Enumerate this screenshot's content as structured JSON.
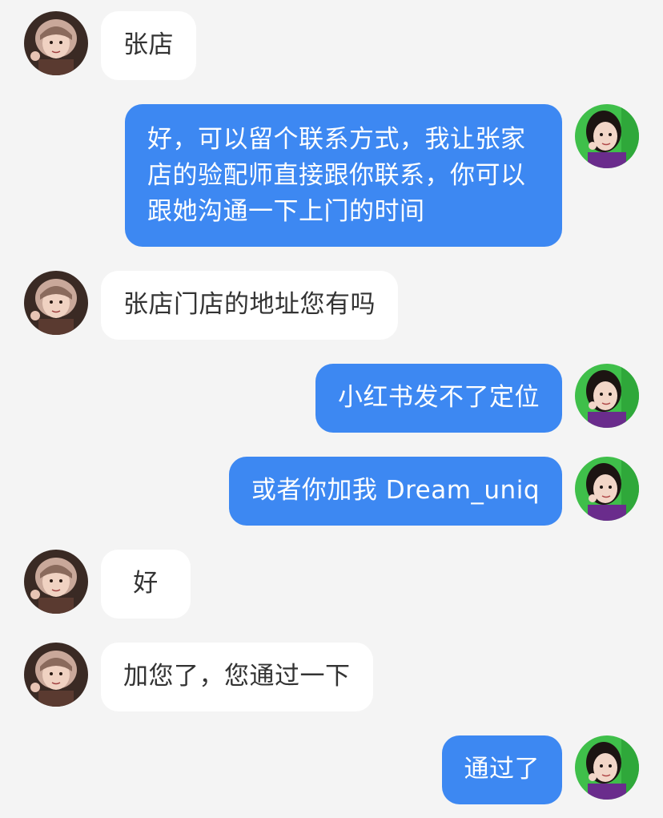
{
  "colors": {
    "background": "#f4f4f4",
    "incoming_bubble": "#ffffff",
    "incoming_text": "#333333",
    "outgoing_bubble": "#3d88f2",
    "outgoing_text": "#ffffff"
  },
  "messages": [
    {
      "side": "left",
      "text": "张店"
    },
    {
      "side": "right",
      "text": "好，可以留个联系方式，我让张家店的验配师直接跟你联系，你可以跟她沟通一下上门的时间"
    },
    {
      "side": "left",
      "text": "张店门店的地址您有吗"
    },
    {
      "side": "right",
      "text": "小红书发不了定位"
    },
    {
      "side": "right",
      "text": "或者你加我 Dream_uniq"
    },
    {
      "side": "left",
      "text": "好"
    },
    {
      "side": "left",
      "text": "加您了，您通过一下"
    },
    {
      "side": "right",
      "text": "通过了"
    }
  ]
}
